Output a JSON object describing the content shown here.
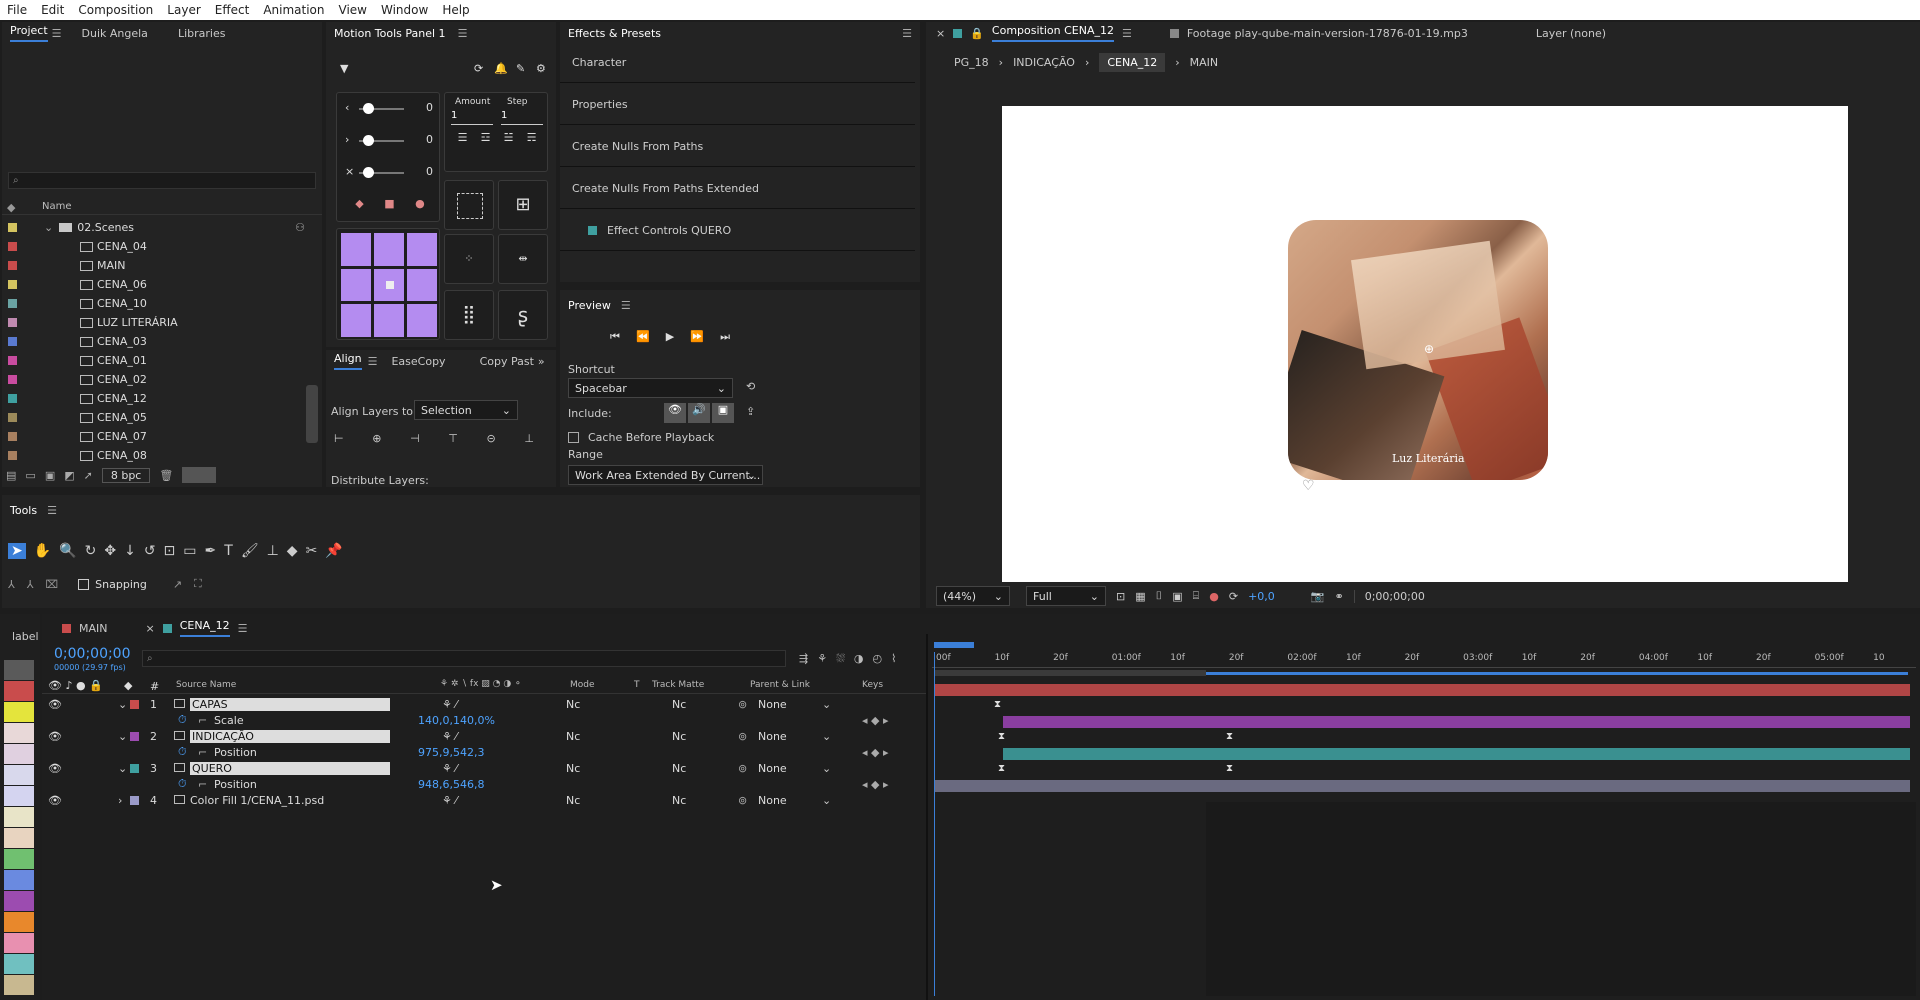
{
  "menu": [
    "File",
    "Edit",
    "Composition",
    "Layer",
    "Effect",
    "Animation",
    "View",
    "Window",
    "Help"
  ],
  "project_panel": {
    "tabs": [
      "Project",
      "Duik Angela",
      "Libraries"
    ],
    "search_placeholder": "",
    "column_name": "Name",
    "folder": "02.Scenes",
    "items": [
      {
        "name": "CENA_04",
        "color": "#c94c4c"
      },
      {
        "name": "MAIN",
        "color": "#c94c4c"
      },
      {
        "name": "CENA_06",
        "color": "#d4c460"
      },
      {
        "name": "CENA_10",
        "color": "#6aa3a3"
      },
      {
        "name": "LUZ LITERÁRIA",
        "color": "#c08ab0"
      },
      {
        "name": "CENA_03",
        "color": "#5a7ad0"
      },
      {
        "name": "CENA_01",
        "color": "#c94ca0"
      },
      {
        "name": "CENA_02",
        "color": "#c94ca0"
      },
      {
        "name": "CENA_12",
        "color": "#3fa0a0"
      },
      {
        "name": "CENA_05",
        "color": "#9c8a5a"
      },
      {
        "name": "CENA_07",
        "color": "#a88060"
      },
      {
        "name": "CENA_08",
        "color": "#a88060"
      }
    ],
    "bpc": "8 bpc"
  },
  "motion_tools": {
    "title": "Motion Tools Panel 1",
    "sliders": [
      "0",
      "0",
      "0"
    ],
    "amount_label": "Amount",
    "step_label": "Step",
    "amount_value": "1",
    "step_value": "1"
  },
  "align_panel": {
    "tabs": [
      "Align",
      "EaseCopy",
      "Copy Past"
    ],
    "align_to_label": "Align Layers to:",
    "align_to_value": "Selection",
    "distribute_label": "Distribute Layers:"
  },
  "effects_panel": {
    "title": "Effects & Presets",
    "items": [
      "Character",
      "Properties",
      "Create Nulls From Paths",
      "Create Nulls From Paths Extended",
      "Effect Controls QUERO"
    ]
  },
  "preview_panel": {
    "title": "Preview",
    "shortcut_label": "Shortcut",
    "shortcut_value": "Spacebar",
    "include_label": "Include:",
    "cache_label": "Cache Before Playback",
    "range_label": "Range",
    "range_value": "Work Area Extended By Current..."
  },
  "tools_panel": {
    "title": "Tools",
    "snapping": "Snapping"
  },
  "composition_panel": {
    "tab": "Composition CENA_12",
    "footage_tab": "Footage play-qube-main-version-17876-01-19.mp3",
    "layer_tab": "Layer (none)",
    "breadcrumb": [
      "PG_18",
      "INDICAÇÃO",
      "CENA_12",
      "MAIN"
    ],
    "zoom": "(44%)",
    "resolution": "Full",
    "exposure": "+0,0",
    "timecode": "0;00;00;00",
    "watermark": "Luz Literária"
  },
  "timeline": {
    "label_strip": "label",
    "tabs": [
      "MAIN",
      "CENA_12"
    ],
    "timecode": "0;00;00;00",
    "fps": "00000 (29.97 fps)",
    "columns": {
      "num": "#",
      "source": "Source Name",
      "mode": "Mode",
      "t": "T",
      "track_matte": "Track Matte",
      "parent": "Parent & Link",
      "keys": "Keys"
    },
    "layers": [
      {
        "num": "1",
        "name": "CAPAS",
        "color": "#c94c4c",
        "mode": "Nc",
        "matte": "Nc",
        "parent": "None",
        "prop": "Scale",
        "value": "140,0,140,0%",
        "bar": "#b04545",
        "bar_start": 0.0
      },
      {
        "num": "2",
        "name": "INDICAÇÃO",
        "color": "#9c4cb0",
        "mode": "Nc",
        "matte": "Nc",
        "parent": "None",
        "prop": "Position",
        "value": "975,9,542,3",
        "bar": "#8a3ea0",
        "bar_start": 0.07
      },
      {
        "num": "3",
        "name": "QUERO",
        "color": "#3fa0a0",
        "mode": "Nc",
        "matte": "Nc",
        "parent": "None",
        "prop": "Position",
        "value": "948,6,546,8",
        "bar": "#3a9090",
        "bar_start": 0.07
      },
      {
        "num": "4",
        "name": "Color Fill 1/CENA_11.psd",
        "color": "#9a9ac8",
        "mode": "Nc",
        "matte": "Nc",
        "parent": "None",
        "bar": "#6a6a80",
        "bar_start": 0.0
      }
    ],
    "ruler": [
      "00f",
      "10f",
      "20f",
      "01:00f",
      "10f",
      "20f",
      "02:00f",
      "10f",
      "20f",
      "03:00f",
      "10f",
      "20f",
      "04:00f",
      "10f",
      "20f",
      "05:00f",
      "10"
    ]
  },
  "label_colors": [
    "#5a5a5a",
    "#c94c4c",
    "#e4e43c",
    "#e8d8d8",
    "#e0d0e0",
    "#d8d8ec",
    "#d4d4f0",
    "#e8e4c8",
    "#e8d4c0",
    "#70c070",
    "#6a8ae0",
    "#9c4cb0",
    "#e8882c",
    "#e890b0",
    "#70c0c0",
    "#c8b890"
  ]
}
